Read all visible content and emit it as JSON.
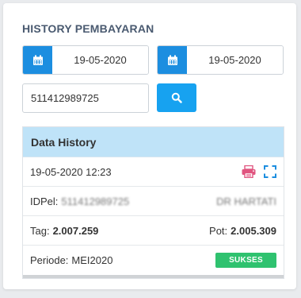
{
  "title": "HISTORY PEMBAYARAN",
  "filters": {
    "date_from": "19-05-2020",
    "date_to": "19-05-2020",
    "idpel": "511412989725"
  },
  "icons": {
    "calendar": "calendar-icon",
    "search": "search-icon",
    "print": "print-icon",
    "expand": "expand-icon"
  },
  "colors": {
    "primary": "#1c8ee0",
    "search": "#17a2f0",
    "header": "#bfe3f8",
    "print": "#e0557f",
    "expand": "#1c8ee0",
    "success": "#2fc26f"
  },
  "panel": {
    "title": "Data History",
    "datetime": "19-05-2020 12:23",
    "idpel_label": "IDPel:",
    "idpel_value": "511412989725",
    "name_value": "DR HARTATI",
    "tag_label": "Tag:",
    "tag_value": "2.007.259",
    "pot_label": "Pot:",
    "pot_value": "2.005.309",
    "periode_label": "Periode:",
    "periode_value": "MEI2020",
    "status": "SUKSES"
  }
}
